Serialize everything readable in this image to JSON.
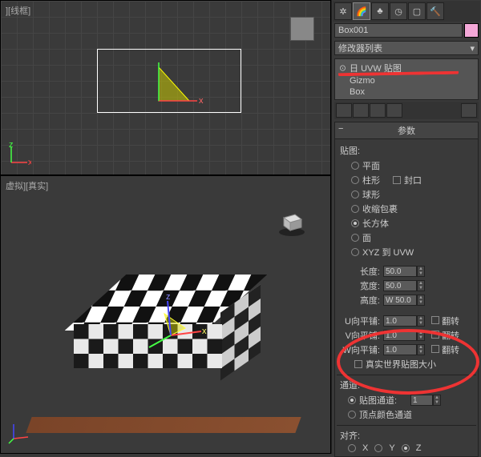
{
  "viewports": {
    "top_label": "][线框]",
    "bottom_label": "虚拟][真实]"
  },
  "object": {
    "name": "Box001"
  },
  "modifier": {
    "dropdown": "修改器列表",
    "stack": [
      "☉ 日 UVW 贴图",
      "Gizmo",
      "Box"
    ]
  },
  "rollouts": {
    "params_title": "参数",
    "mapping": {
      "title": "贴图:",
      "items": [
        "平面",
        "柱形",
        "球形",
        "收缩包裹",
        "长方体",
        "面",
        "XYZ 到 UVW"
      ],
      "selected": 4,
      "cap_label": "封口"
    },
    "dims": {
      "length_l": "长度:",
      "length_v": "50.0",
      "width_l": "宽度:",
      "width_v": "50.0",
      "height_l": "高度:",
      "height_v": "W 50.0"
    },
    "tile": {
      "u_l": "U向平铺:",
      "u_v": "1.0",
      "v_l": "V向平铺:",
      "v_v": "1.0",
      "w_l": "W向平铺:",
      "w_v": "1.0",
      "flip": "翻转",
      "real_world": "真实世界贴图大小"
    },
    "channel": {
      "title": "通道:",
      "map_ch": "贴图通道:",
      "map_ch_v": "1",
      "vert_ch": "顶点颜色通道"
    },
    "align": {
      "title": "对齐:",
      "x": "X",
      "y": "Y",
      "z": "Z"
    }
  }
}
